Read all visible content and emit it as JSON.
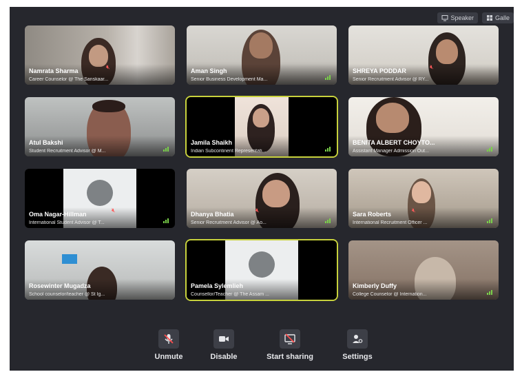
{
  "view_buttons": {
    "speaker": "Speaker",
    "gallery": "Galle"
  },
  "participants": [
    {
      "name": "Namrata Sharma",
      "role": "Career Counselor @ The Sanskaar..."
    },
    {
      "name": "Aman Singh",
      "role": "Senior Business Development Ma..."
    },
    {
      "name": "SHREYA PODDAR",
      "role": "Senior Recruitment Advisor @ RY..."
    },
    {
      "name": "Atul Bakshi",
      "role": "Student Recruitment Advisor @ M..."
    },
    {
      "name": "Jamila Shaikh",
      "role": "Indian Subcontinent Representati..."
    },
    {
      "name": "BENITA ALBERT CHOYTO...",
      "role": "Assistant Manager Admission Out..."
    },
    {
      "name": "Oma Nagar-Hillman",
      "role": "International Student Advisor @ T..."
    },
    {
      "name": "Dhanya Bhatia",
      "role": "Senior Recruitment Advisor @ Ao..."
    },
    {
      "name": "Sara Roberts",
      "role": "International Recruitment Officer ..."
    },
    {
      "name": "Rosewinter Mugadza",
      "role": "School counselor/teacher @ St Ig..."
    },
    {
      "name": "Pamela Sylemlieh",
      "role": "Counsellor/Teacher @ The Assam ..."
    },
    {
      "name": "Kimberly Duffy",
      "role": "College Counselor @ Internation..."
    }
  ],
  "toolbar": {
    "unmute": "Unmute",
    "disable": "Disable",
    "start_sharing": "Start sharing",
    "settings": "Settings"
  },
  "colors": {
    "background": "#26272d",
    "active_border": "#c8d23c",
    "muted_mic": "#ff5a5a",
    "signal": "#7ad14a"
  }
}
